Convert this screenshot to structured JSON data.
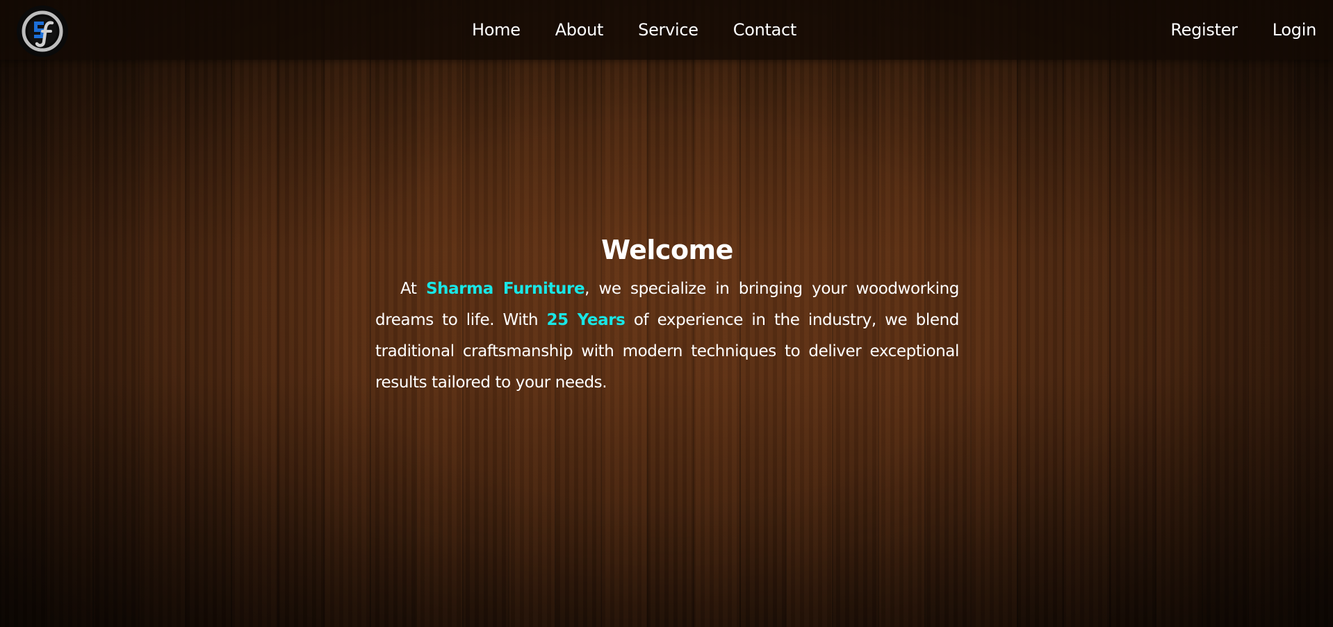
{
  "brand": {
    "logo_icon": "sf-logo-icon",
    "logo_text": "SF",
    "colors": {
      "ring": "#c8c8c8",
      "letter_s": "#1c6fd8",
      "letter_f": "#d0d0d0"
    }
  },
  "nav": {
    "items": [
      {
        "label": "Home"
      },
      {
        "label": "About"
      },
      {
        "label": "Service"
      },
      {
        "label": "Contact"
      }
    ],
    "auth": {
      "register_label": "Register",
      "login_label": "Login"
    }
  },
  "hero": {
    "title": "Welcome",
    "intro_pre": "At ",
    "company_name": "Sharma Furniture",
    "intro_mid": ", we specialize in bringing your woodworking dreams to life. With ",
    "years": "25 Years",
    "intro_post": " of experience in the industry, we blend traditional craftsmanship with modern techniques to deliver exceptional results tailored to your needs."
  },
  "theme": {
    "accent": "#19e6e6",
    "background": "#3a200f",
    "navbar_bg": "#140a04",
    "text": "#ffffff"
  }
}
